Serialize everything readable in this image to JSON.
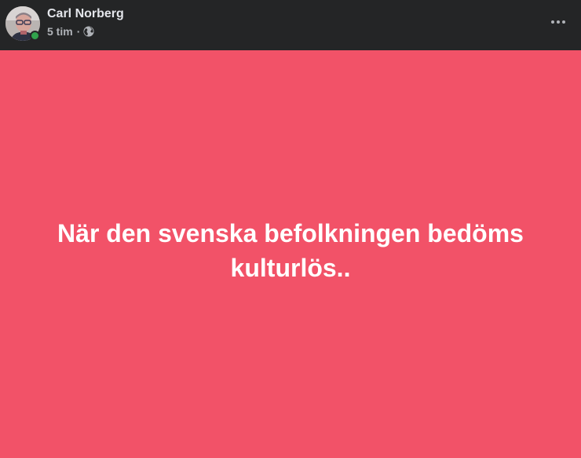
{
  "post": {
    "author": "Carl Norberg",
    "time": "5 tim",
    "separator": "·",
    "audience_icon": "globe-icon",
    "more_icon": "more-options-icon",
    "text": "När den svenska befolkningen bedöms kulturlös..",
    "background_color": "#f25268",
    "online": true
  }
}
